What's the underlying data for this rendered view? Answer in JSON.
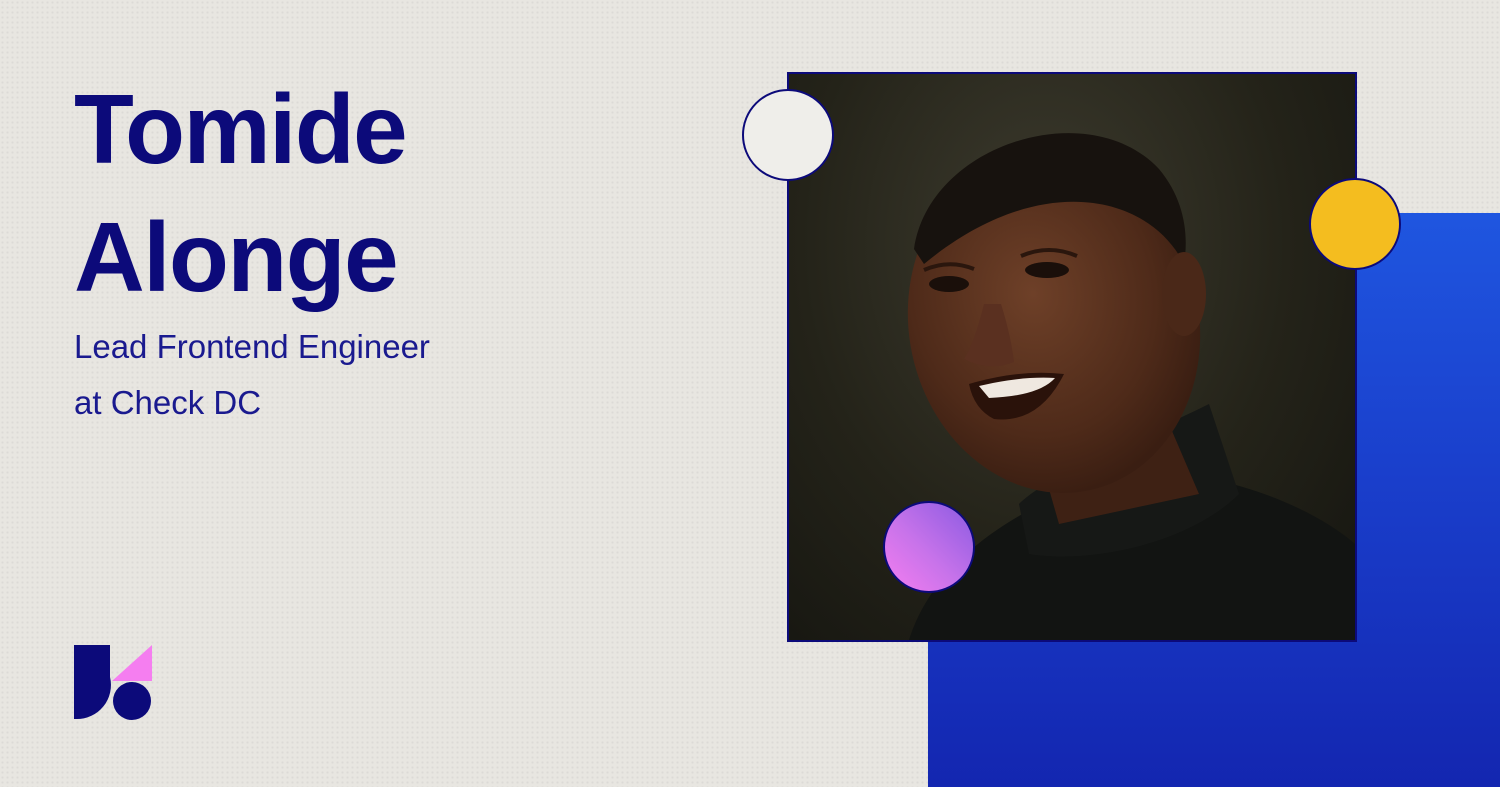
{
  "speaker": {
    "first_name": "Tomide",
    "last_name": "Alonge",
    "role_line1": "Lead Frontend Engineer",
    "role_line2": "at Check DC"
  },
  "colors": {
    "background": "#e8e6e1",
    "text_primary": "#0c0a7a",
    "accent_blue": "#1a3fcc",
    "accent_yellow": "#f4bd1f",
    "accent_pink": "#f57ef0",
    "accent_purple": "#8a5ae2"
  },
  "icons": {
    "logo": "brand-logo-icon",
    "circle_white": "white-circle-icon",
    "circle_yellow": "yellow-circle-icon",
    "circle_purple": "purple-gradient-circle-icon"
  }
}
